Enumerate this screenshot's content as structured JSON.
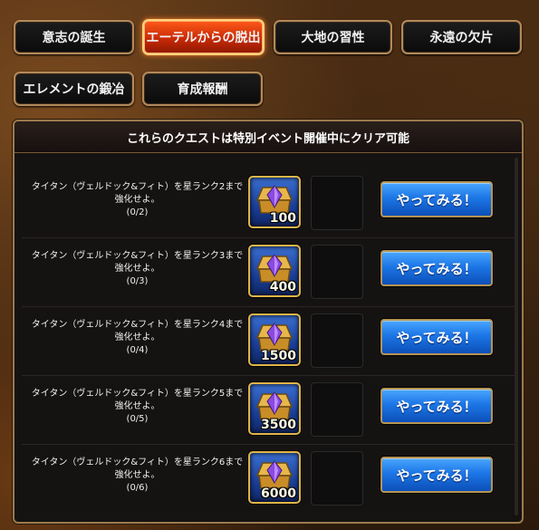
{
  "tabs": [
    {
      "label": "意志の誕生",
      "active": false
    },
    {
      "label": "エーテルからの脱出",
      "active": true
    },
    {
      "label": "大地の習性",
      "active": false
    },
    {
      "label": "永遠の欠片",
      "active": false
    },
    {
      "label": "エレメントの鍛冶",
      "active": false
    },
    {
      "label": "育成報酬",
      "active": false
    }
  ],
  "panel": {
    "header": "これらのクエストは特別イベント開催中にクリア可能"
  },
  "quests": [
    {
      "text": "タイタン（ヴェルドック&フィト）を星ランク2まで強化せよ。",
      "progress": "(0/2)",
      "reward_icon": "crystal-chest-icon",
      "reward_qty": "100",
      "button": "やってみる！"
    },
    {
      "text": "タイタン（ヴェルドック&フィト）を星ランク3まで強化せよ。",
      "progress": "(0/3)",
      "reward_icon": "crystal-chest-icon",
      "reward_qty": "400",
      "button": "やってみる！"
    },
    {
      "text": "タイタン（ヴェルドック&フィト）を星ランク4まで強化せよ。",
      "progress": "(0/4)",
      "reward_icon": "crystal-chest-icon",
      "reward_qty": "1500",
      "button": "やってみる！"
    },
    {
      "text": "タイタン（ヴェルドック&フィト）を星ランク5まで強化せよ。",
      "progress": "(0/5)",
      "reward_icon": "crystal-chest-icon",
      "reward_qty": "3500",
      "button": "やってみる！"
    },
    {
      "text": "タイタン（ヴェルドック&フィト）を星ランク6まで強化せよ。",
      "progress": "(0/6)",
      "reward_icon": "crystal-chest-icon",
      "reward_qty": "6000",
      "button": "やってみる！"
    }
  ],
  "colors": {
    "active_tab": "#e8440e",
    "button_blue": "#1c76e6",
    "frame_gold": "#e0b548"
  }
}
